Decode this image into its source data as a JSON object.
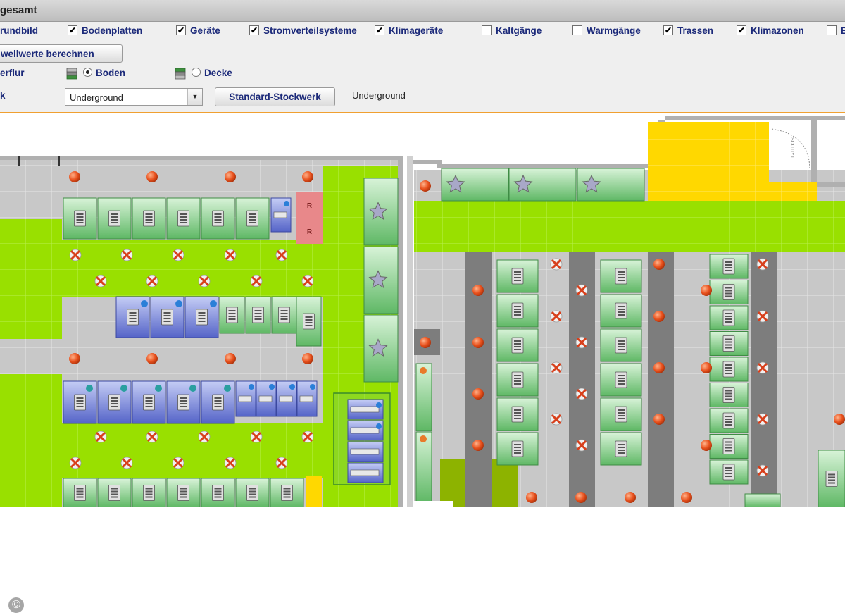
{
  "window": {
    "title": "gesamt"
  },
  "layers": {
    "items": [
      {
        "label": "rundbild",
        "checked": true
      },
      {
        "label": "Bodenplatten",
        "checked": true
      },
      {
        "label": "Geräte",
        "checked": true
      },
      {
        "label": "Stromverteilsysteme",
        "checked": true
      },
      {
        "label": "Klimageräte",
        "checked": true
      },
      {
        "label": "Kaltgänge",
        "checked": false
      },
      {
        "label": "Warmgänge",
        "checked": false
      },
      {
        "label": "Trassen",
        "checked": true
      },
      {
        "label": "Klimazonen",
        "checked": true
      },
      {
        "label": "B",
        "checked": false
      }
    ]
  },
  "toolbar": {
    "calc_button": "wellwerte berechnen",
    "level_label": "erflur",
    "radio_floor": "Boden",
    "radio_ceiling": "Decke",
    "floor_selected": "Boden",
    "storey_label": "k",
    "storey_select_value": "Underground",
    "standard_button": "Standard-Stockwerk",
    "current_storey": "Underground"
  },
  "floorplan": {
    "rack_letter": "R",
    "door_label": "SCUTIYT",
    "copyright": "©",
    "colors": {
      "tile_gray": "#c8c8c8",
      "tile_green": "#99e000",
      "aisle_dark": "#7d7d7d",
      "yellow": "#ffd800",
      "olive": "#8db300",
      "pink": "#e8888a",
      "rack_green": "#72c878",
      "rack_blue": "#7b88d8",
      "sensor_red": "#e8501c",
      "wall": "#b0b0b0"
    },
    "icons": [
      "server-rack-icon",
      "sensor-dot-icon",
      "cooling-fan-icon",
      "star-unit-icon",
      "network-device-icon",
      "network-badge-icon"
    ]
  }
}
